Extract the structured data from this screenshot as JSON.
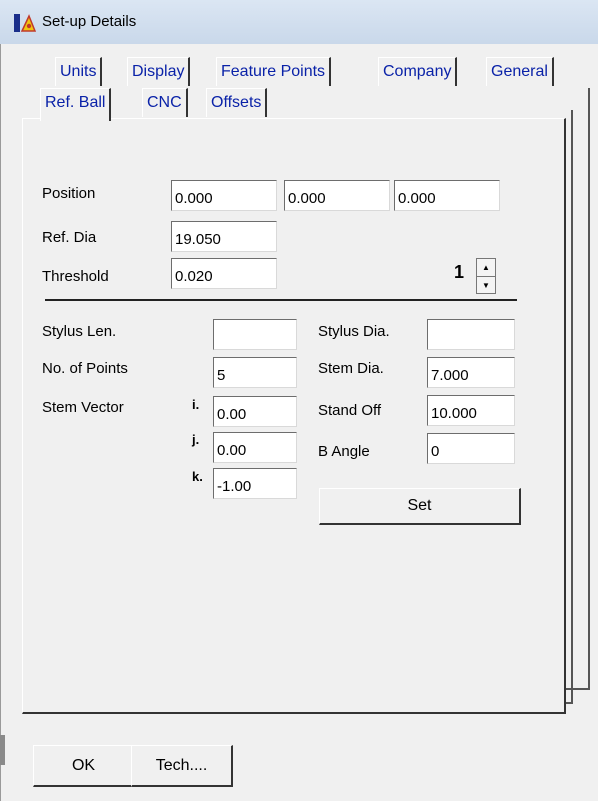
{
  "window": {
    "title": "Set-up Details",
    "icon": "app-icon"
  },
  "tabs_row1": [
    {
      "label": "Units"
    },
    {
      "label": "Display"
    },
    {
      "label": "Feature Points"
    },
    {
      "label": "Company"
    },
    {
      "label": "General"
    }
  ],
  "tabs_row2": [
    {
      "label": "Ref. Ball"
    },
    {
      "label": "CNC"
    },
    {
      "label": "Offsets"
    }
  ],
  "active_tab": "Ref. Ball",
  "refball": {
    "position_label": "Position",
    "position_x": "0.000",
    "position_y": "0.000",
    "position_z": "0.000",
    "refdia_label": "Ref. Dia",
    "refdia_value": "19.050",
    "threshold_label": "Threshold",
    "threshold_value": "0.020",
    "spinner_value": "1"
  },
  "stylus": {
    "stylus_len_label": "Stylus Len.",
    "stylus_len_value": "",
    "num_points_label": "No. of Points",
    "num_points_value": "5",
    "stem_vector_label": "Stem Vector",
    "i_label": "i.",
    "j_label": "j.",
    "k_label": "k.",
    "i_value": "0.00",
    "j_value": "0.00",
    "k_value": "-1.00",
    "stylus_dia_label": "Stylus Dia.",
    "stylus_dia_value": "",
    "stem_dia_label": "Stem Dia.",
    "stem_dia_value": "7.000",
    "stand_off_label": "Stand Off",
    "stand_off_value": "10.000",
    "b_angle_label": "B Angle",
    "b_angle_value": "0",
    "set_label": "Set"
  },
  "footer": {
    "ok_label": "OK",
    "tech_label": "Tech...."
  },
  "colors": {
    "tab_text": "#0a22a8",
    "face": "#f0f0f0"
  }
}
